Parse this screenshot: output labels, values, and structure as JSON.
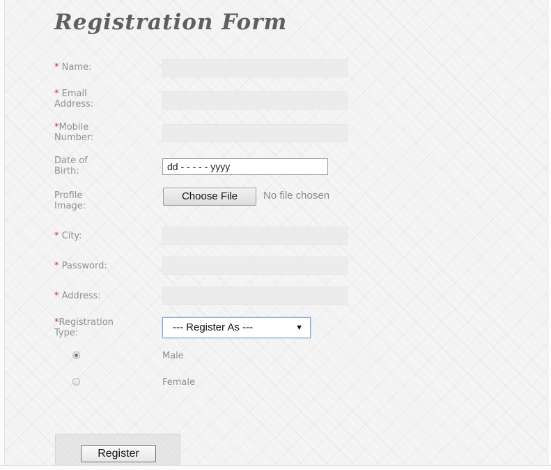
{
  "form": {
    "title": "Registration Form",
    "fields": {
      "name": {
        "required_mark": "*",
        "label": "Name:"
      },
      "email": {
        "required_mark": "*",
        "label": "Email",
        "label2": "Address:"
      },
      "mobile": {
        "required_mark": "*",
        "label": "Mobile",
        "label2": "Number:"
      },
      "dob": {
        "label": "Date of",
        "label2": "Birth:",
        "placeholder": "dd - - - - - yyyy"
      },
      "profile_image": {
        "label": "Profile",
        "label2": "Image:",
        "button_label": "Choose File",
        "status": "No file chosen"
      },
      "city": {
        "required_mark": "*",
        "label": "City:"
      },
      "password": {
        "required_mark": "*",
        "label": "Password:"
      },
      "address": {
        "required_mark": "*",
        "label": "Address:"
      },
      "registration_type": {
        "required_mark": "*",
        "label": "Registration",
        "label2": "Type:",
        "selected": "--- Register As ---",
        "arrow": "▼"
      }
    },
    "gender": {
      "options": [
        {
          "label": "Male",
          "checked": true
        },
        {
          "label": "Female",
          "checked": false
        }
      ]
    },
    "submit_label": "Register"
  },
  "colors": {
    "required": "#c0392b",
    "label": "#8f8f8f",
    "title": "#5f5f5f",
    "focus_border": "#7fa7d6"
  }
}
